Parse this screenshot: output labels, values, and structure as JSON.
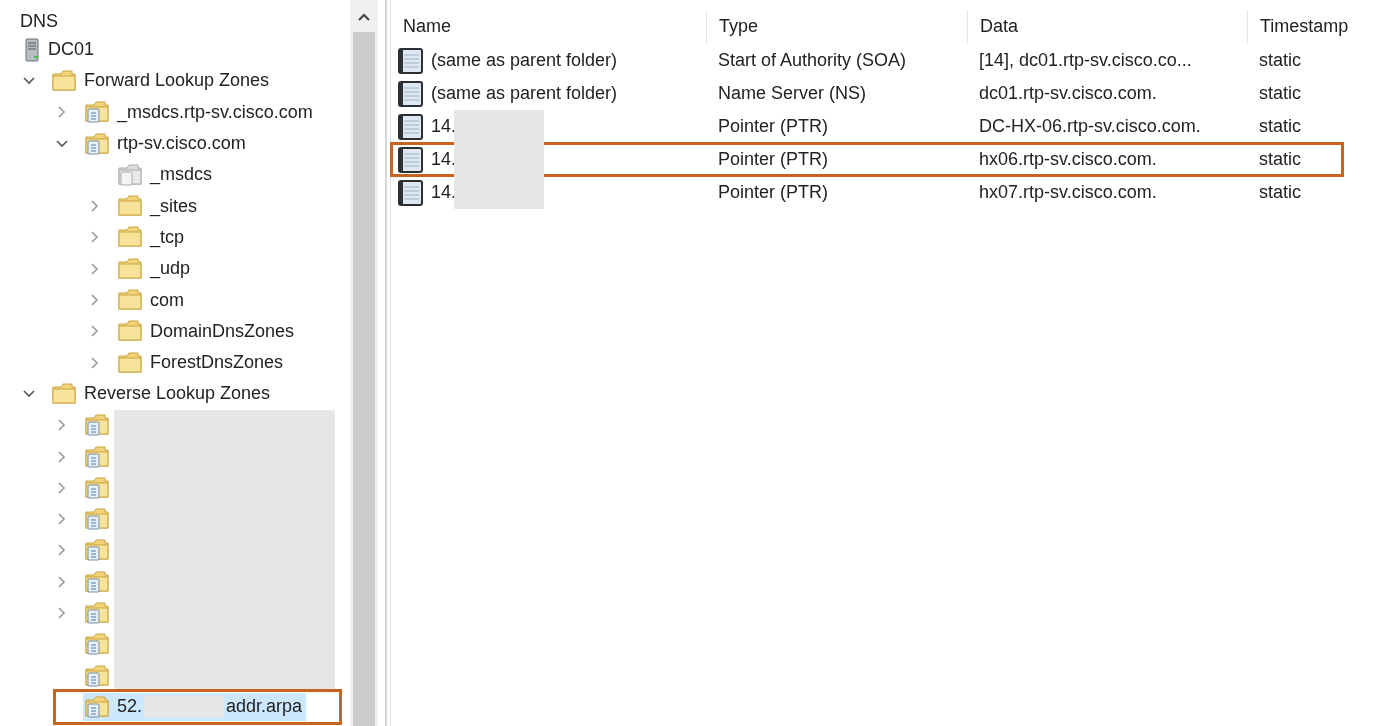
{
  "tree": {
    "root": "DNS",
    "server": {
      "label": "DC01",
      "kind": "server",
      "children": [
        {
          "label": "Forward Lookup Zones",
          "kind": "folder",
          "expanded": true,
          "children": [
            {
              "label": "_msdcs.rtp-sv.cisco.com",
              "kind": "zone",
              "expanded": false
            },
            {
              "label": "rtp-sv.cisco.com",
              "kind": "zone",
              "expanded": true,
              "children": [
                {
                  "label": "_msdcs",
                  "kind": "delegation"
                },
                {
                  "label": "_sites",
                  "kind": "folder",
                  "expanded": false
                },
                {
                  "label": "_tcp",
                  "kind": "folder",
                  "expanded": false
                },
                {
                  "label": "_udp",
                  "kind": "folder",
                  "expanded": false
                },
                {
                  "label": "com",
                  "kind": "folder",
                  "expanded": false
                },
                {
                  "label": "DomainDnsZones",
                  "kind": "folder",
                  "expanded": false
                },
                {
                  "label": "ForestDnsZones",
                  "kind": "folder",
                  "expanded": false
                }
              ]
            }
          ]
        },
        {
          "label": "Reverse Lookup Zones",
          "kind": "folder",
          "expanded": true,
          "children": [
            {
              "kind": "zone",
              "expanded": false,
              "redacted": true
            },
            {
              "kind": "zone",
              "expanded": false,
              "redacted": true
            },
            {
              "kind": "zone",
              "expanded": false,
              "redacted": true
            },
            {
              "kind": "zone",
              "expanded": false,
              "redacted": true
            },
            {
              "kind": "zone",
              "expanded": false,
              "redacted": true
            },
            {
              "kind": "zone",
              "expanded": false,
              "redacted": true
            },
            {
              "kind": "zone",
              "expanded": false,
              "redacted": true
            },
            {
              "kind": "zone",
              "redacted": true
            },
            {
              "kind": "zone",
              "redacted": true
            },
            {
              "label": "52.",
              "label_end": "addr.arpa",
              "kind": "zone",
              "selected": true,
              "highlighted": true,
              "redacted": true
            }
          ]
        }
      ]
    }
  },
  "table": {
    "columns": [
      "Name",
      "Type",
      "Data",
      "Timestamp"
    ],
    "rows": [
      {
        "name": "(same as parent folder)",
        "type": "Start of Authority (SOA)",
        "data": "[14], dc01.rtp-sv.cisco.co...",
        "timestamp": "static",
        "redacted": false,
        "highlighted": false
      },
      {
        "name": "(same as parent folder)",
        "type": "Name Server (NS)",
        "data": "dc01.rtp-sv.cisco.com.",
        "timestamp": "static",
        "redacted": false,
        "highlighted": false
      },
      {
        "name": "14.",
        "type": "Pointer (PTR)",
        "data": "DC-HX-06.rtp-sv.cisco.com.",
        "timestamp": "static",
        "redacted": true,
        "highlighted": false
      },
      {
        "name": "14.",
        "type": "Pointer (PTR)",
        "data": "hx06.rtp-sv.cisco.com.",
        "timestamp": "static",
        "redacted": true,
        "highlighted": true
      },
      {
        "name": "14.",
        "type": "Pointer (PTR)",
        "data": "hx07.rtp-sv.cisco.com.",
        "timestamp": "static",
        "redacted": true,
        "highlighted": false
      }
    ]
  }
}
